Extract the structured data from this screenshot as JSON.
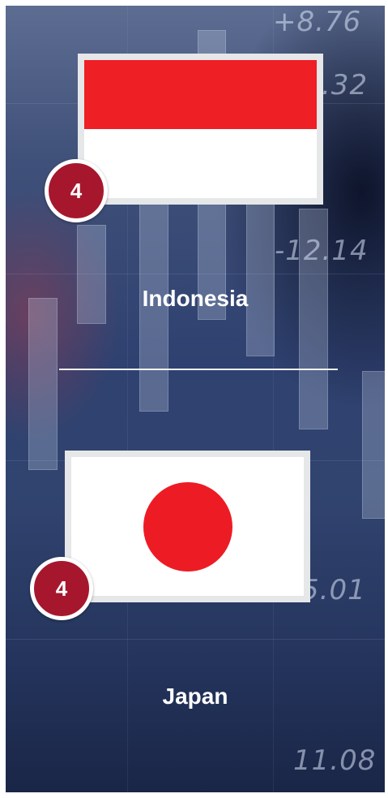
{
  "background": {
    "tickers": [
      "+8.76",
      ".32",
      "-12.14",
      "5.01",
      "11.08"
    ]
  },
  "colors": {
    "badge": "#a6172d",
    "flag_red": "#ee1f25",
    "flag_frame": "#e6e7e9",
    "text": "#ffffff"
  },
  "items": [
    {
      "country": "Indonesia",
      "count": "4",
      "flag": "indonesia-flag"
    },
    {
      "country": "Japan",
      "count": "4",
      "flag": "japan-flag"
    }
  ]
}
